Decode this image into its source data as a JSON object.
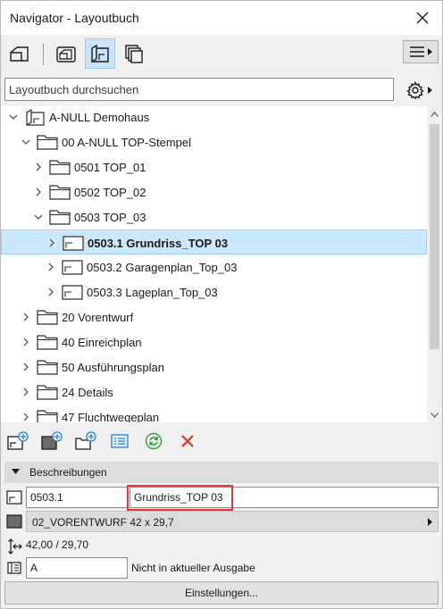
{
  "window": {
    "title": "Navigator - Layoutbuch"
  },
  "search": {
    "placeholder": "Layoutbuch durchsuchen",
    "value": ""
  },
  "tree": [
    {
      "label": "A-NULL Demohaus",
      "depth": 0,
      "expanded": true,
      "icon": "layoutbook-icon",
      "bold": false,
      "selected": false
    },
    {
      "label": "00 A-NULL TOP-Stempel",
      "depth": 1,
      "expanded": true,
      "icon": "folder-icon",
      "bold": false,
      "selected": false
    },
    {
      "label": "0501 TOP_01",
      "depth": 2,
      "expanded": false,
      "icon": "folder-icon",
      "bold": false,
      "selected": false
    },
    {
      "label": "0502 TOP_02",
      "depth": 2,
      "expanded": false,
      "icon": "folder-icon",
      "bold": false,
      "selected": false
    },
    {
      "label": "0503 TOP_03",
      "depth": 2,
      "expanded": true,
      "icon": "folder-icon",
      "bold": false,
      "selected": false
    },
    {
      "label": "0503.1 Grundriss_TOP 03",
      "depth": 3,
      "expanded": false,
      "icon": "layout-icon",
      "bold": true,
      "selected": true
    },
    {
      "label": "0503.2 Garagenplan_Top_03",
      "depth": 3,
      "expanded": false,
      "icon": "layout-icon",
      "bold": false,
      "selected": false
    },
    {
      "label": "0503.3 Lageplan_Top_03",
      "depth": 3,
      "expanded": false,
      "icon": "layout-icon",
      "bold": false,
      "selected": false
    },
    {
      "label": "20 Vorentwurf",
      "depth": 1,
      "expanded": false,
      "icon": "folder-icon",
      "bold": false,
      "selected": false
    },
    {
      "label": "40 Einreichplan",
      "depth": 1,
      "expanded": false,
      "icon": "folder-icon",
      "bold": false,
      "selected": false
    },
    {
      "label": "50 Ausführungsplan",
      "depth": 1,
      "expanded": false,
      "icon": "folder-icon",
      "bold": false,
      "selected": false
    },
    {
      "label": "24 Details",
      "depth": 1,
      "expanded": false,
      "icon": "folder-icon",
      "bold": false,
      "selected": false
    },
    {
      "label": "47 Fluchtwegeplan",
      "depth": 1,
      "expanded": false,
      "icon": "folder-icon",
      "bold": false,
      "selected": false
    }
  ],
  "description": {
    "header": "Beschreibungen",
    "id_value": "0503.1",
    "name_value": "Grundriss_TOP 03",
    "master_layout": "02_VORENTWURF 42 x 29,7",
    "size": "42,00 / 29,70",
    "revision_value": "A",
    "revision_status": "Nicht in aktueller Ausgabe",
    "settings_label": "Einstellungen..."
  },
  "colors": {
    "selection_bg": "#cce8ff",
    "active_tool_bg": "#cce4f7",
    "highlight_border": "#e0383b",
    "refresh_green": "#2e9e3e",
    "delete_red": "#e0302c",
    "add_blue": "#1e7fd8"
  }
}
